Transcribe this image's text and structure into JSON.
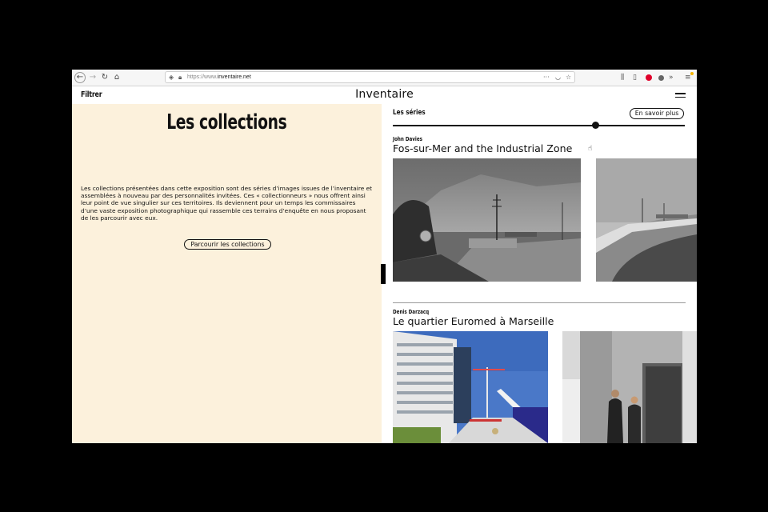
{
  "browser": {
    "url_prefix": "https://www.",
    "url_domain": "inventaire.net",
    "icons": [
      "back-icon",
      "forward-icon",
      "reload-icon",
      "home-icon",
      "shield-icon",
      "lock-icon",
      "more-icon",
      "pocket-icon",
      "bookmark-star-icon",
      "library-icon",
      "sidebar-icon",
      "opera-icon",
      "account-icon",
      "overflow-icon",
      "menu-icon"
    ]
  },
  "header": {
    "filter_label": "Filtrer",
    "logo": "Inventaire"
  },
  "left": {
    "title": "Les collections",
    "body": "Les collections présentées dans cette exposition sont des séries d’images issues de l’inventaire et assemblées à nouveau par des personnalités invitées. Ces « collectionneurs » nous offrent ainsi leur point de vue singulier sur ces territoires. Ils deviennent pour un temps les commissaires d’une vaste exposition photographique qui rassemble ces terrains d’enquête en nous proposant de les parcourir avec eux.",
    "button": "Parcourir les collections",
    "background": "#fcf1dc"
  },
  "right": {
    "heading": "Les séries",
    "more_button": "En savoir plus",
    "slider_position": 0.7,
    "collections": [
      {
        "author": "John Davies",
        "title": "Fos-sur-Mer and the Industrial Zone"
      },
      {
        "author": "Denis Darzacq",
        "title": "Le quartier Euromed à Marseille"
      }
    ]
  }
}
